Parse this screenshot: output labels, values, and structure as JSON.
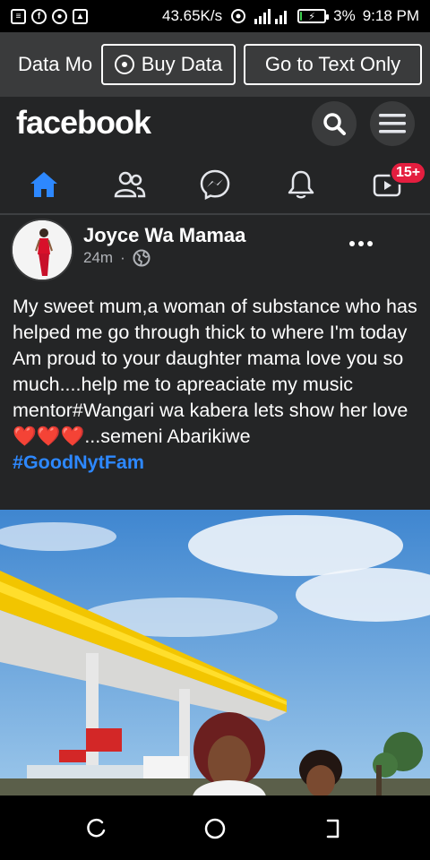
{
  "status_bar": {
    "network_speed": "43.65K/s",
    "battery_percent": "3%",
    "time": "9:18 PM",
    "battery_level": 0.03,
    "icons": [
      "news-icon",
      "facebook-icon",
      "record-icon",
      "image-icon",
      "hotspot-icon",
      "signal-icon",
      "battery-icon"
    ]
  },
  "data_bar": {
    "mode_label": "Data Mo",
    "buy_data_label": "Buy Data",
    "text_only_label": "Go to Text Only"
  },
  "header": {
    "logo": "facebook",
    "icons": [
      "search-icon",
      "menu-icon"
    ],
    "nav": [
      "home-icon",
      "friends-icon",
      "messenger-icon",
      "bell-icon",
      "watch-icon"
    ],
    "watch_badge": "15+",
    "accent_color": "#2d88ff"
  },
  "post": {
    "author": "Joyce Wa Mamaa",
    "time": "24m",
    "separator": "·",
    "text_main": "My sweet mum,a woman of substance who has helped me go through thick to where I'm today Am proud to your daughter  mama love you so much....help me to apreaciate my music mentor#Wangari wa kabera lets show her love",
    "hearts": "❤️❤️❤️",
    "text_tail": "...semeni Abarikiwe",
    "hashtag": "#GoodNytFam"
  }
}
